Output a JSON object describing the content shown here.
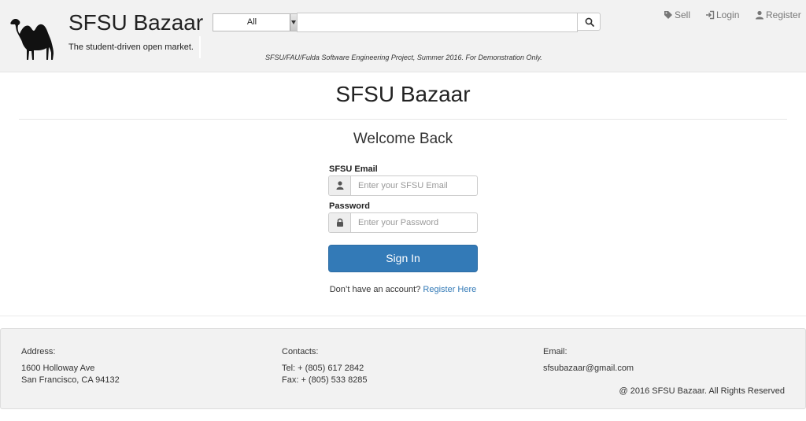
{
  "header": {
    "brand_title": "SFSU Bazaar",
    "tagline": "The student-driven open market.",
    "logo_icon": "camel-icon",
    "search": {
      "category_selected": "All",
      "placeholder": "",
      "button_icon": "search-icon"
    },
    "project_note": "SFSU/FAU/Fulda Software Engineering Project, Summer 2016. For Demonstration Only.",
    "nav": {
      "sell": "Sell",
      "login": "Login",
      "register": "Register"
    }
  },
  "main": {
    "title": "SFSU Bazaar",
    "subtitle": "Welcome Back",
    "email_label": "SFSU Email",
    "email_placeholder": "Enter your SFSU Email",
    "password_label": "Password",
    "password_placeholder": "Enter your Password",
    "signin_label": "Sign In",
    "no_account_text": "Don’t have an account?",
    "register_link": "Register Here"
  },
  "footer": {
    "address_heading": "Address:",
    "address_line1": "1600 Holloway Ave",
    "address_line2": "San Francisco, CA 94132",
    "contacts_heading": "Contacts:",
    "tel": "Tel: + (805) 617 2842",
    "fax": "Fax: + (805) 533 8285",
    "email_heading": "Email:",
    "email": "sfsubazaar@gmail.com",
    "copyright": "@ 2016 SFSU Bazaar. All Rights Reserved"
  },
  "colors": {
    "primary": "#337ab7",
    "header_bg": "#f2f2f2",
    "footer_bg": "#f2f2f2"
  }
}
